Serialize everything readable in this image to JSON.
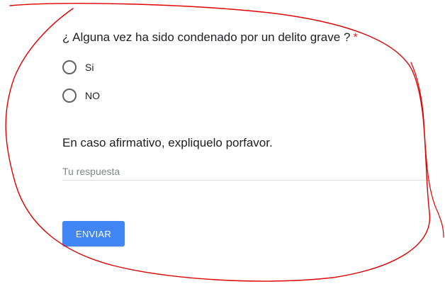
{
  "question1": {
    "title": "¿ Alguna vez ha sido condenado por un delito grave ?",
    "required_marker": "*",
    "options": [
      {
        "label": "Si"
      },
      {
        "label": "NO"
      }
    ]
  },
  "question2": {
    "title": "En caso afirmativo, expliquelo porfavor.",
    "placeholder": "Tu respuesta",
    "value": ""
  },
  "submit": {
    "label": "ENVIAR"
  },
  "colors": {
    "accent": "#4285f4",
    "required": "#d93025",
    "annotation": "#e00000"
  }
}
